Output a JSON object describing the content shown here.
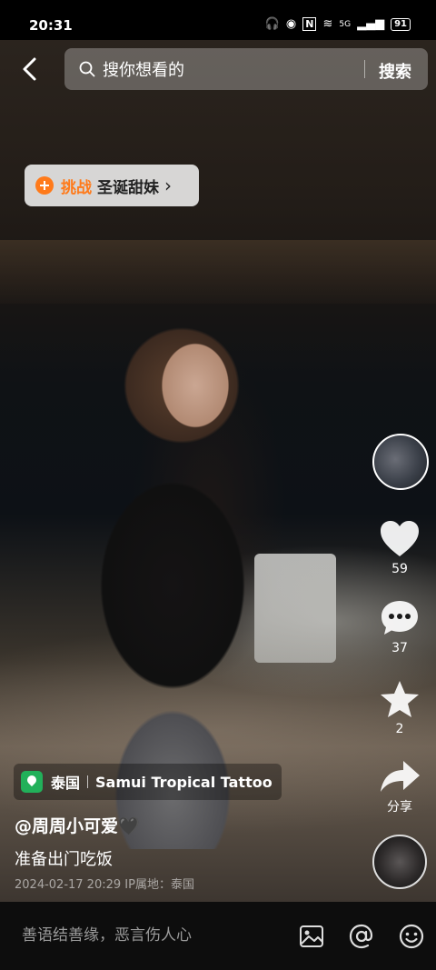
{
  "status_bar": {
    "time": "20:31",
    "network": "5G",
    "battery": "91"
  },
  "header": {
    "back_icon": "back-arrow-icon",
    "search_placeholder": "搜你想看的",
    "search_button": "搜索"
  },
  "challenge": {
    "tag": "挑战",
    "name": "圣诞甜妹",
    "arrow": "›"
  },
  "right_rail": {
    "like_count": "59",
    "comment_count": "37",
    "favorite_count": "2",
    "share_label": "分享"
  },
  "video_info": {
    "location_country": "泰国",
    "location_place": "Samui Tropical Tattoo",
    "username": "@周周小可爱",
    "username_emoji": "🖤",
    "caption": "准备出门吃饭",
    "meta": "2024-02-17 20:29  IP属地：泰国"
  },
  "comment_bar": {
    "placeholder": "善语结善缘，恶言伤人心"
  },
  "colors": {
    "accent_orange": "#ff7a1a",
    "location_green": "#22b05a"
  }
}
